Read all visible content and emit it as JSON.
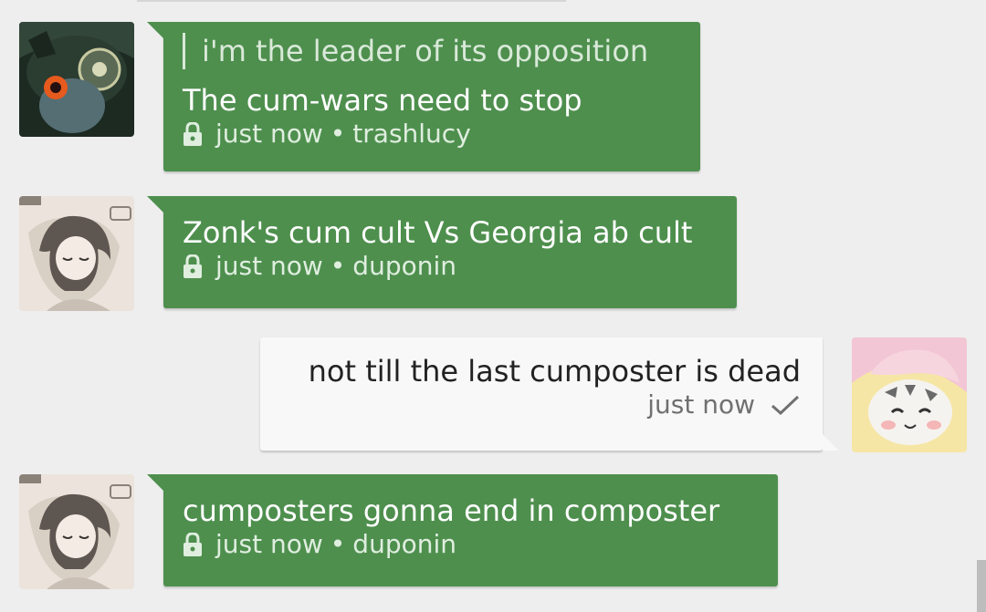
{
  "messages": [
    {
      "direction": "incoming",
      "avatar_icon": "midna-avatar",
      "quote": "i'm the leader of its opposition",
      "text": "The cum-wars need to stop",
      "time": "just now",
      "separator": "•",
      "author": "trashlucy"
    },
    {
      "direction": "incoming",
      "avatar_icon": "sleeping-girl-avatar",
      "text": "Zonk's cum cult Vs Georgia ab cult",
      "time": "just now",
      "separator": "•",
      "author": "duponin"
    },
    {
      "direction": "outgoing",
      "avatar_icon": "cat-in-bag-avatar",
      "text": "not till the last cumposter is dead",
      "time": "just now",
      "status_icon": "checkmark-icon"
    },
    {
      "direction": "incoming",
      "avatar_icon": "sleeping-girl-avatar",
      "text": "cumposters gonna end in composter",
      "time": "just now",
      "separator": "•",
      "author": "duponin"
    }
  ],
  "colors": {
    "background": "#eeeeee",
    "incoming_bubble": "#4e8f4e",
    "outgoing_bubble": "#f8f8f8"
  }
}
